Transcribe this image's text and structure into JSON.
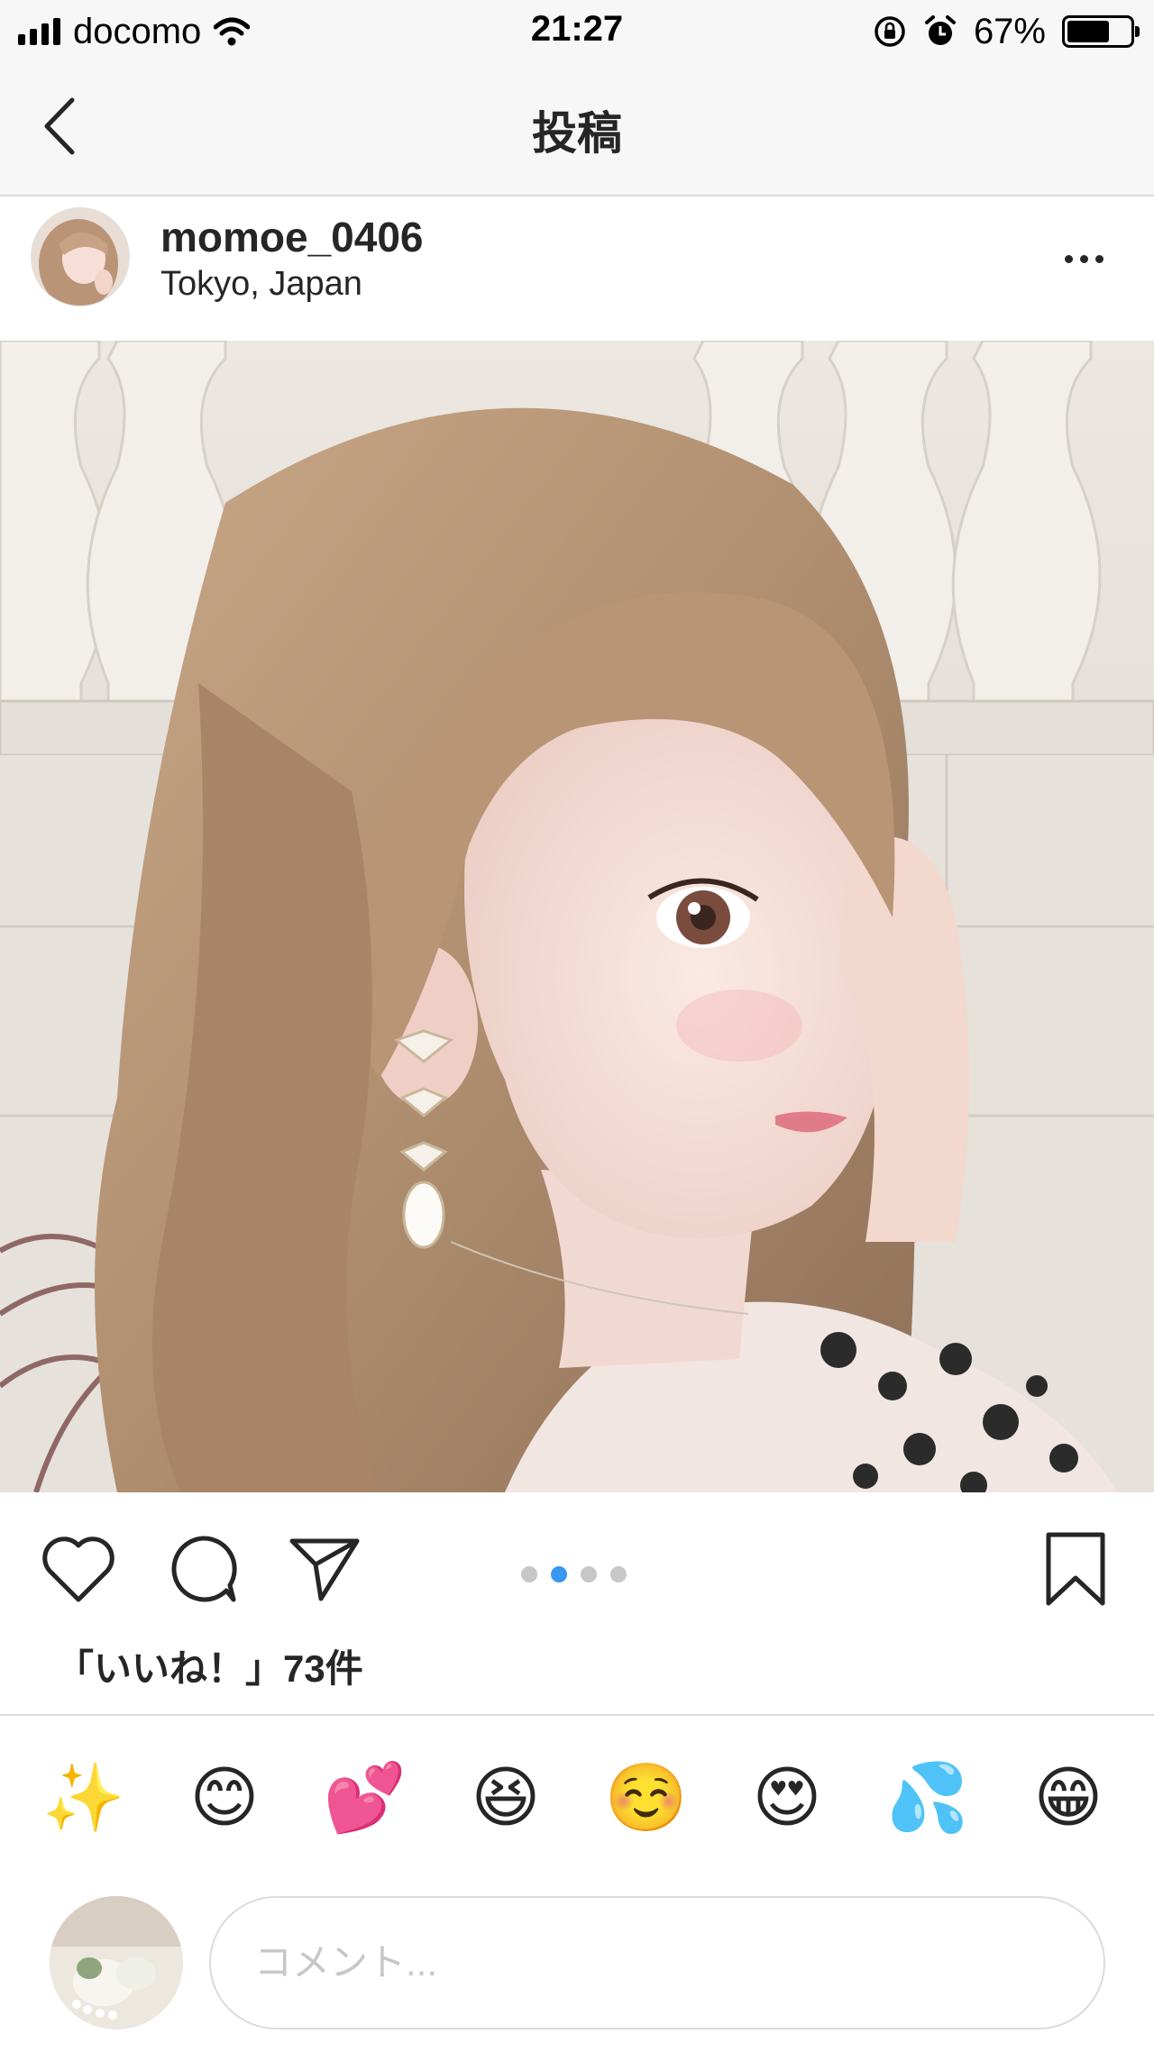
{
  "status_bar": {
    "carrier": "docomo",
    "time": "21:27",
    "battery_percent": "67%",
    "battery_level": 0.67
  },
  "nav": {
    "title": "投稿"
  },
  "post": {
    "username": "momoe_0406",
    "location": "Tokyo, Japan",
    "photo_pages": 4,
    "photo_current_page": 2,
    "likes_text": "「いいね！」73件"
  },
  "emoji_bar": {
    "items": [
      "✨",
      "😊",
      "💕",
      "😆",
      "☺️",
      "😍",
      "💦",
      "😁"
    ]
  },
  "comment": {
    "placeholder": "コメント..."
  },
  "colors": {
    "active_dot": "#3897f0",
    "inactive_dot": "#c7c7c7",
    "text": "#262626",
    "divider": "#dbdbdb"
  }
}
